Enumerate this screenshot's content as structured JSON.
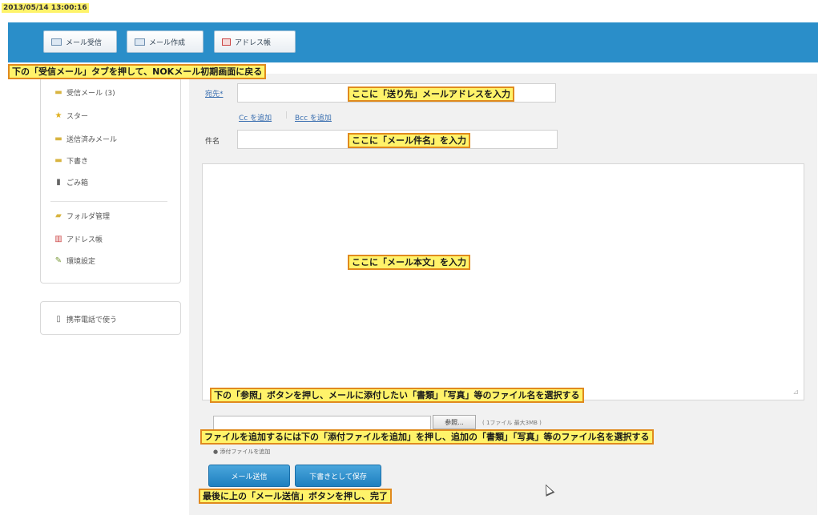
{
  "timestamp": "2013/05/14 13:00:16",
  "nav": {
    "inbox_tab": "メール受信",
    "compose_tab": "メール作成",
    "address_tab": "アドレス帳"
  },
  "sidebar": {
    "items": [
      {
        "label": "受信メール (3)",
        "icon": "folder-icon"
      },
      {
        "label": "スター",
        "icon": "star-icon"
      },
      {
        "label": "送信済みメール",
        "icon": "folder-icon"
      },
      {
        "label": "下書き",
        "icon": "folder-icon"
      },
      {
        "label": "ごみ箱",
        "icon": "trash-icon"
      },
      {
        "label": "フォルダ管理",
        "icon": "folder-settings-icon"
      },
      {
        "label": "アドレス帳",
        "icon": "book-icon"
      },
      {
        "label": "環境設定",
        "icon": "wrench-icon"
      }
    ],
    "mobile": "携帯電話で使う"
  },
  "compose": {
    "to_label": "宛先*",
    "cc_link": "Cc を追加",
    "bcc_link": "Bcc を追加",
    "subject_label": "件名",
    "browse_label": "参照...",
    "file_info": "( 1ファイル 最大3MB )",
    "add_file": "添付ファイルを追加",
    "send_label": "メール送信",
    "draft_label": "下書きとして保存",
    "resize_glyph": "⊿"
  },
  "annotations": {
    "inbox_note": "下の「受信メール」タブを押して、NOKメール初期画面に戻る",
    "to_note": "ここに「送り先」メールアドレスを入力",
    "subject_note": "ここに「メール件名」を入力",
    "body_note": "ここに「メール本文」を入力",
    "browse_note": "下の「参照」ボタンを押し、メールに添付したい「書類」「写真」等のファイル名を選択する",
    "addfile_note": "ファイルを追加するには下の「添付ファイルを追加」を押し、追加の「書類」「写真」等のファイル名を選択する",
    "send_note": "最後に上の「メール送信」ボタンを押し、完了"
  },
  "colors": {
    "topbar": "#2a8ec9",
    "note_bg": "#fff36a",
    "note_border": "#e08a1e",
    "button_blue": "#1e7fbf"
  }
}
